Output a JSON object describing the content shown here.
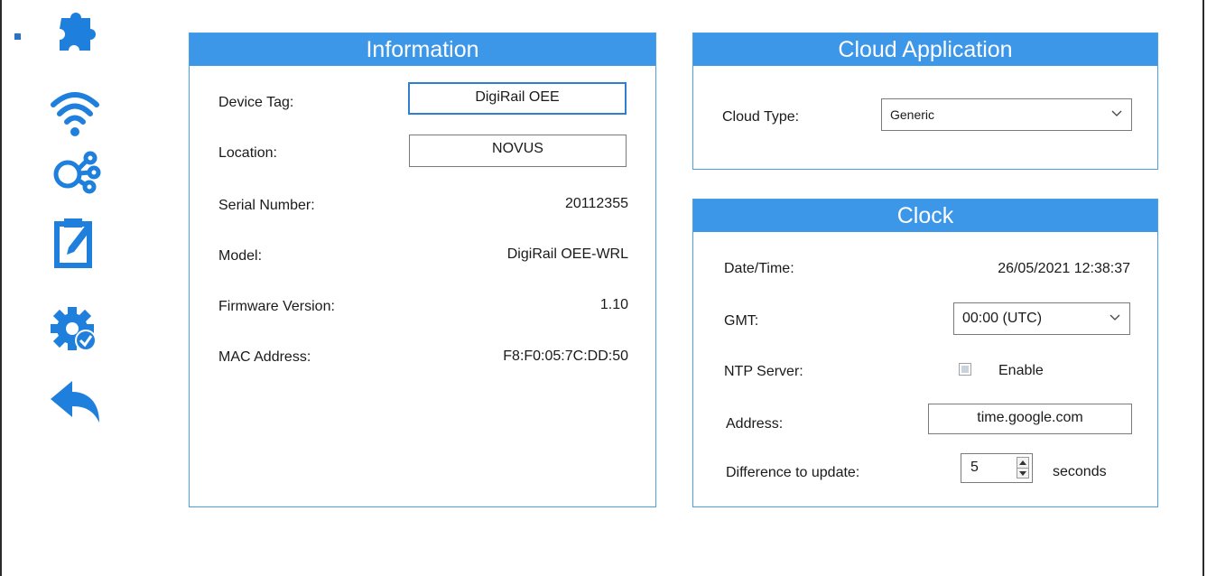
{
  "sidebar": {
    "icons": [
      {
        "name": "puzzle-icon",
        "active": true
      },
      {
        "name": "wifi-icon"
      },
      {
        "name": "network-nodes-icon"
      },
      {
        "name": "edit-clipboard-icon"
      },
      {
        "name": "settings-gear-check-icon"
      },
      {
        "name": "back-arrow-icon"
      }
    ],
    "accent_color": "#2b73c7"
  },
  "information": {
    "title": "Information",
    "device_tag_label": "Device Tag:",
    "device_tag_value": "DigiRail OEE",
    "location_label": "Location:",
    "location_value": "NOVUS",
    "serial_label": "Serial Number:",
    "serial_value": "20112355",
    "model_label": "Model:",
    "model_value": "DigiRail OEE-WRL",
    "firmware_label": "Firmware Version:",
    "firmware_value": "1.10",
    "mac_label": "MAC Address:",
    "mac_value": "F8:F0:05:7C:DD:50"
  },
  "cloud": {
    "title": "Cloud Application",
    "cloud_type_label": "Cloud Type:",
    "cloud_type_value": "Generic"
  },
  "clock": {
    "title": "Clock",
    "datetime_label": "Date/Time:",
    "datetime_value": "26/05/2021 12:38:37",
    "gmt_label": "GMT:",
    "gmt_value": "00:00 (UTC)",
    "ntp_label": "NTP Server:",
    "ntp_enable_label": "Enable",
    "ntp_enabled": false,
    "address_label": "Address:",
    "address_value": "time.google.com",
    "diff_label": "Difference to update:",
    "diff_value": "5",
    "diff_unit": "seconds"
  },
  "colors": {
    "panel_header": "#3c97e9",
    "panel_border": "#4aa0e6",
    "icon_blue": "#1e7fdc"
  }
}
